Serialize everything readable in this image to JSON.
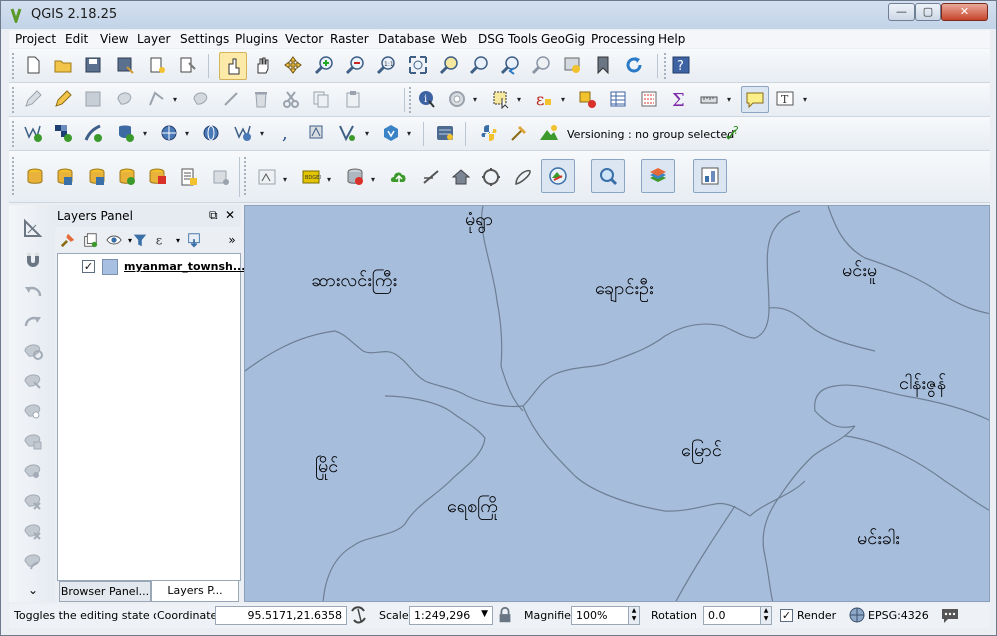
{
  "window": {
    "title": "QGIS 2.18.25",
    "minimize": "—",
    "maximize": "▢",
    "close": "✕"
  },
  "menu": [
    "Project",
    "Edit",
    "View",
    "Layer",
    "Settings",
    "Plugins",
    "Vector",
    "Raster",
    "Database",
    "Web",
    "DSG Tools",
    "GeoGig",
    "Processing",
    "Help"
  ],
  "versioning": "Versioning : no group selected",
  "layers_panel": {
    "title": "Layers Panel",
    "layer_name": "myanmar_townsh...",
    "layer_checked": "✓",
    "tabs": [
      "Browser Panel...",
      "Layers P..."
    ],
    "more": "»"
  },
  "map_labels": {
    "top": "မုံရွာ",
    "nw": "ဆားလင်းကြီး",
    "north": "ချောင်းဦး",
    "ne": "မင်းမူ",
    "east": "ငါန်းဇွန်",
    "west": "မြိုင်",
    "center": "မြောင်",
    "sw": "ရေစကြို",
    "se": "မင်းခါး"
  },
  "status": {
    "message": "Toggles the editing state of tl",
    "coordinate_label": "Coordinate",
    "coordinate": "95.5171,21.6358",
    "scale_label": "Scale",
    "scale": "1:249,296",
    "magnifier_label": "Magnifier",
    "magnifier": "100%",
    "rotation_label": "Rotation",
    "rotation": "0.0",
    "render_label": "Render",
    "render_checked": "✓",
    "crs": "EPSG:4326"
  },
  "colors": {
    "map_fill": "#a6bddc",
    "border_line": "#6e7f93",
    "layer_swatch": "#a7bfe0"
  }
}
